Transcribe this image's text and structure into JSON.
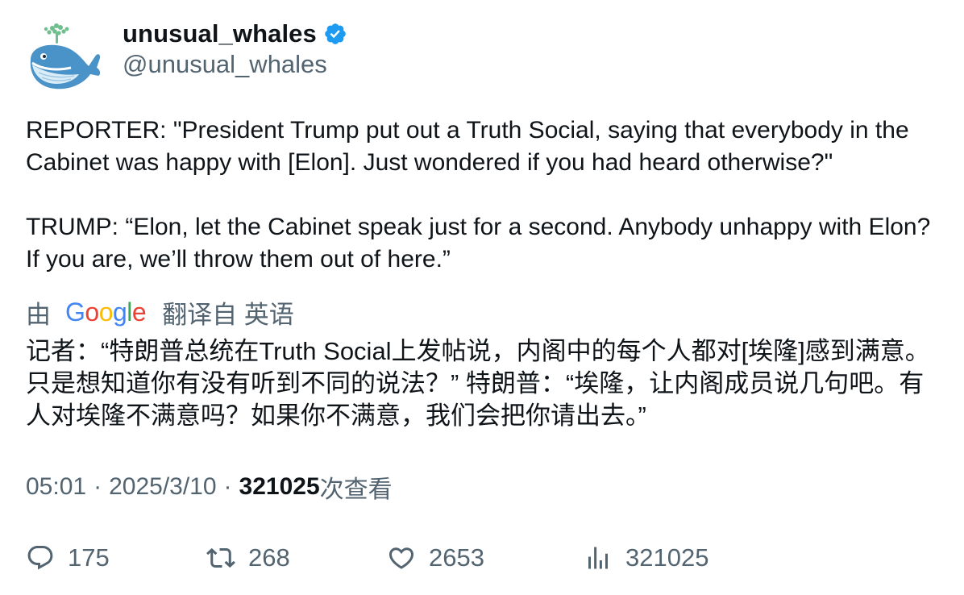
{
  "author": {
    "display_name": "unusual_whales",
    "handle": "@unusual_whales",
    "verified": true,
    "avatar_icon": "whale-icon"
  },
  "tweet": {
    "paragraphs": [
      "REPORTER: \"President Trump put out a Truth Social, saying that everybody in the Cabinet was happy with [Elon]. Just wondered if you had heard otherwise?\"",
      "TRUMP: “Elon, let the Cabinet speak just for a second. Anybody unhappy with Elon? If you are, we’ll throw them out of here.”"
    ]
  },
  "translation": {
    "by_label": "由",
    "provider": "Google",
    "action_label": "翻译自 英语",
    "text": "记者：“特朗普总统在Truth Social上发帖说，内阁中的每个人都对[埃隆]感到满意。只是想知道你有没有听到不同的说法？” 特朗普：“埃隆，让内阁成员说几句吧。有人对埃隆不满意吗？如果你不满意，我们会把你请出去。”"
  },
  "meta": {
    "time": "05:01",
    "date": "2025/3/10",
    "separator": "·",
    "views_count": "321025",
    "views_label": "次查看"
  },
  "actions": {
    "reply_count": "175",
    "retweet_count": "268",
    "like_count": "2653",
    "views_count": "321025"
  },
  "colors": {
    "text_primary": "#0f1419",
    "text_secondary": "#536471",
    "verified_blue": "#1d9bf0",
    "google_blue": "#4285F4",
    "google_red": "#EA4335",
    "google_yellow": "#FBBC05",
    "google_green": "#34A853"
  }
}
